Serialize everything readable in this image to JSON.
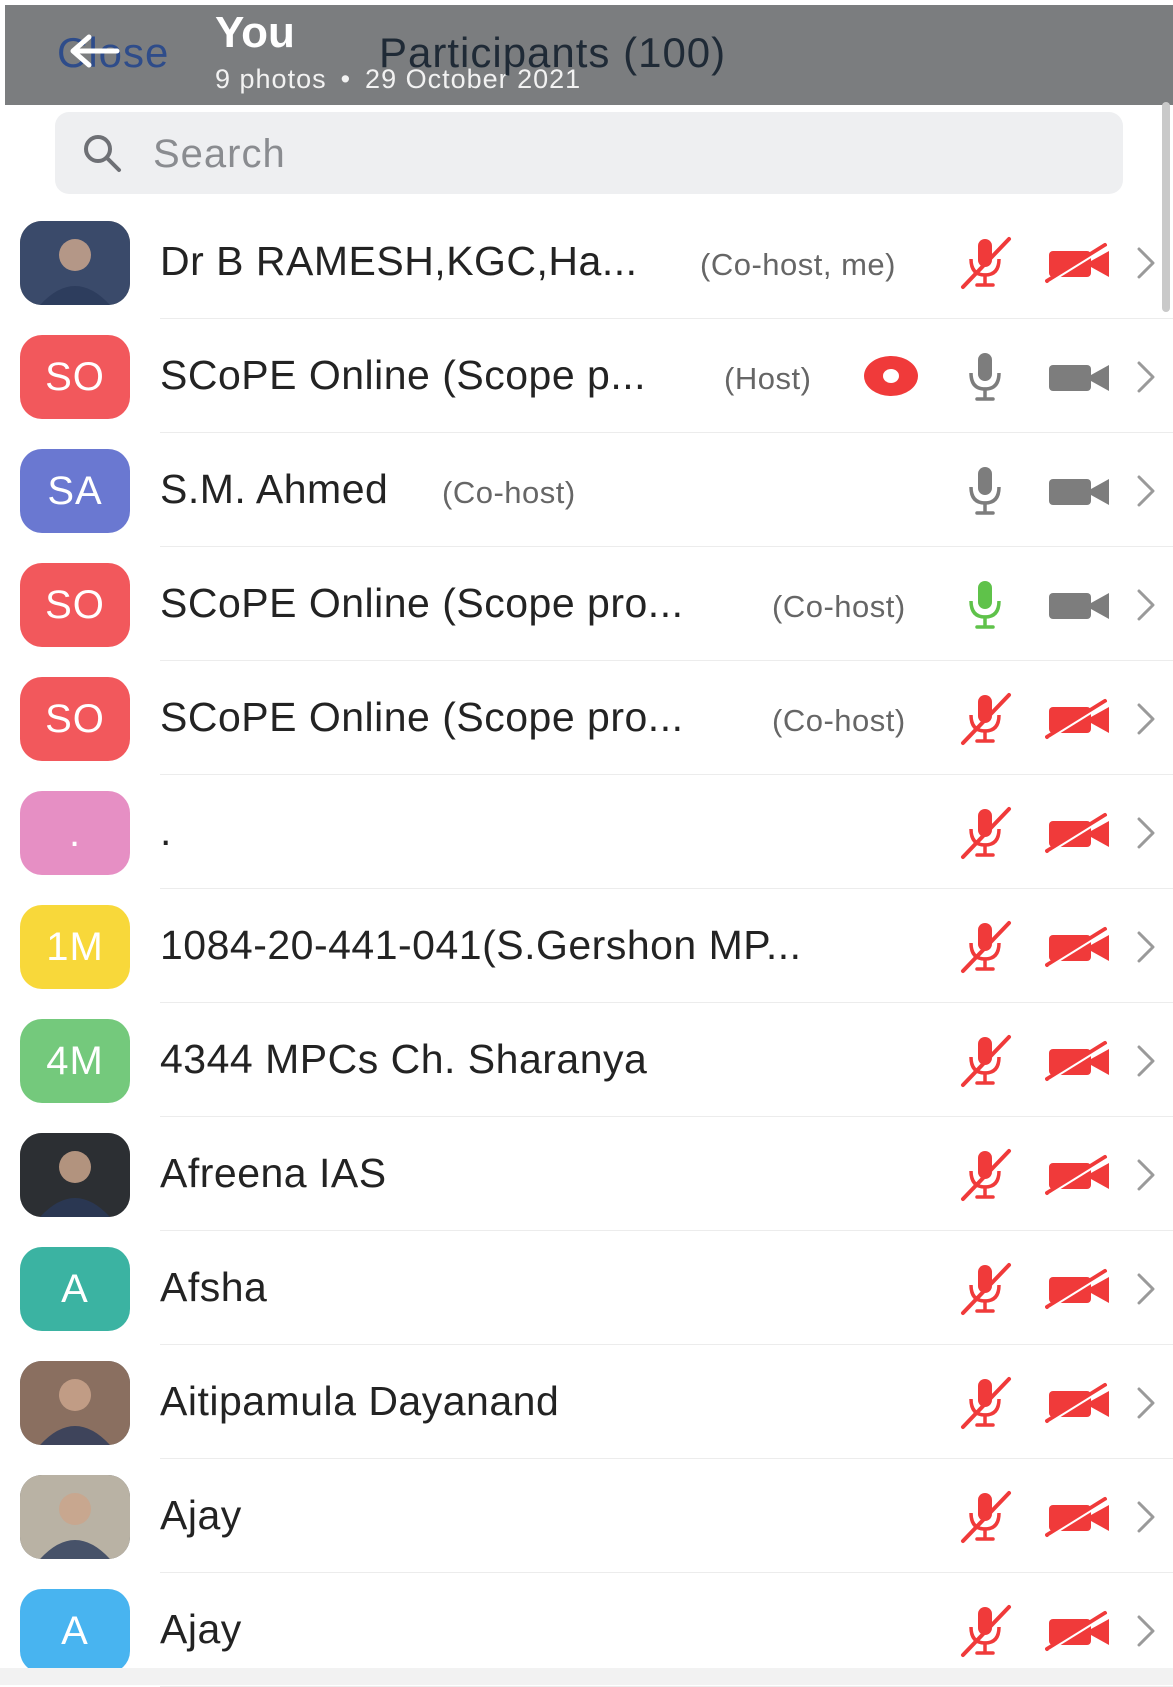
{
  "header": {
    "close_label": "Close",
    "you_label": "You",
    "photos_count": "9 photos",
    "separator": "•",
    "date": "29 October 2021",
    "title": "Participants (100)"
  },
  "search": {
    "placeholder": "Search"
  },
  "colors": {
    "header_bg": "#7b7d7f",
    "muted_red": "#f03a3a",
    "active_green": "#5fc24a",
    "inactive_gray": "#7d7d7d"
  },
  "participants": [
    {
      "initials": "",
      "avatar": "photo",
      "color": "#3a4a6a",
      "name": "Dr B RAMESH,KGC,Ha...",
      "role": "(Co-host, me)",
      "mic": "muted",
      "video": "off",
      "recording": false
    },
    {
      "initials": "SO",
      "avatar": "initials",
      "color": "#f2585c",
      "name": "SCoPE Online (Scope p...",
      "role": "(Host)",
      "mic": "on",
      "video": "on",
      "recording": true
    },
    {
      "initials": "SA",
      "avatar": "initials",
      "color": "#6a78d1",
      "name": "S.M. Ahmed",
      "role": "(Co-host)",
      "mic": "on",
      "video": "on",
      "recording": false
    },
    {
      "initials": "SO",
      "avatar": "initials",
      "color": "#f2585c",
      "name": "SCoPE Online (Scope pro...",
      "role": "(Co-host)",
      "mic": "active",
      "video": "on",
      "recording": false
    },
    {
      "initials": "SO",
      "avatar": "initials",
      "color": "#f2585c",
      "name": "SCoPE Online (Scope pro...",
      "role": "(Co-host)",
      "mic": "muted",
      "video": "off",
      "recording": false
    },
    {
      "initials": ".",
      "avatar": "initials",
      "color": "#e68fc4",
      "name": ".",
      "role": "",
      "mic": "muted",
      "video": "off",
      "recording": false
    },
    {
      "initials": "1M",
      "avatar": "initials",
      "color": "#f8d83a",
      "name": "1084-20-441-041(S.Gershon MP...",
      "role": "",
      "mic": "muted",
      "video": "off",
      "recording": false
    },
    {
      "initials": "4M",
      "avatar": "initials",
      "color": "#74c97c",
      "name": "4344 MPCs Ch. Sharanya",
      "role": "",
      "mic": "muted",
      "video": "off",
      "recording": false
    },
    {
      "initials": "",
      "avatar": "photo",
      "color": "#2c2f33",
      "name": "Afreena IAS",
      "role": "",
      "mic": "muted",
      "video": "off",
      "recording": false
    },
    {
      "initials": "A",
      "avatar": "initials",
      "color": "#3bb3a2",
      "name": "Afsha",
      "role": "",
      "mic": "muted",
      "video": "off",
      "recording": false
    },
    {
      "initials": "",
      "avatar": "photo",
      "color": "#8a6f60",
      "name": "Aitipamula Dayanand",
      "role": "",
      "mic": "muted",
      "video": "off",
      "recording": false
    },
    {
      "initials": "",
      "avatar": "photo",
      "color": "#b9b2a4",
      "name": "Ajay",
      "role": "",
      "mic": "muted",
      "video": "off",
      "recording": false
    },
    {
      "initials": "A",
      "avatar": "initials",
      "color": "#48b4f0",
      "name": "Ajay",
      "role": "",
      "mic": "muted",
      "video": "off",
      "recording": false
    }
  ]
}
